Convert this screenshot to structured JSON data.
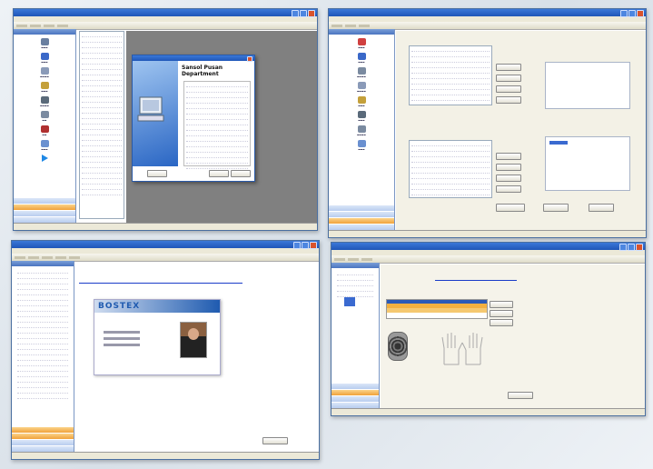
{
  "shots": {
    "tl": {
      "dialog": {
        "heading_line1": "Sansol Pusan",
        "heading_line2": "Department"
      }
    },
    "bl": {
      "card": {
        "logo": "BOSTEX"
      }
    }
  },
  "colors": {
    "title_blue": "#1f56b8",
    "nav_orange": "#f0a23a",
    "nav_blue": "#b8cdef",
    "card_blue": "#1f5bb0",
    "workspace_gray": "#808080"
  },
  "icons": [
    "users-icon",
    "group-icon",
    "door-icon",
    "key-icon",
    "schedule-icon",
    "report-icon",
    "play-icon",
    "fingerprint-icon",
    "id-photo-icon"
  ]
}
